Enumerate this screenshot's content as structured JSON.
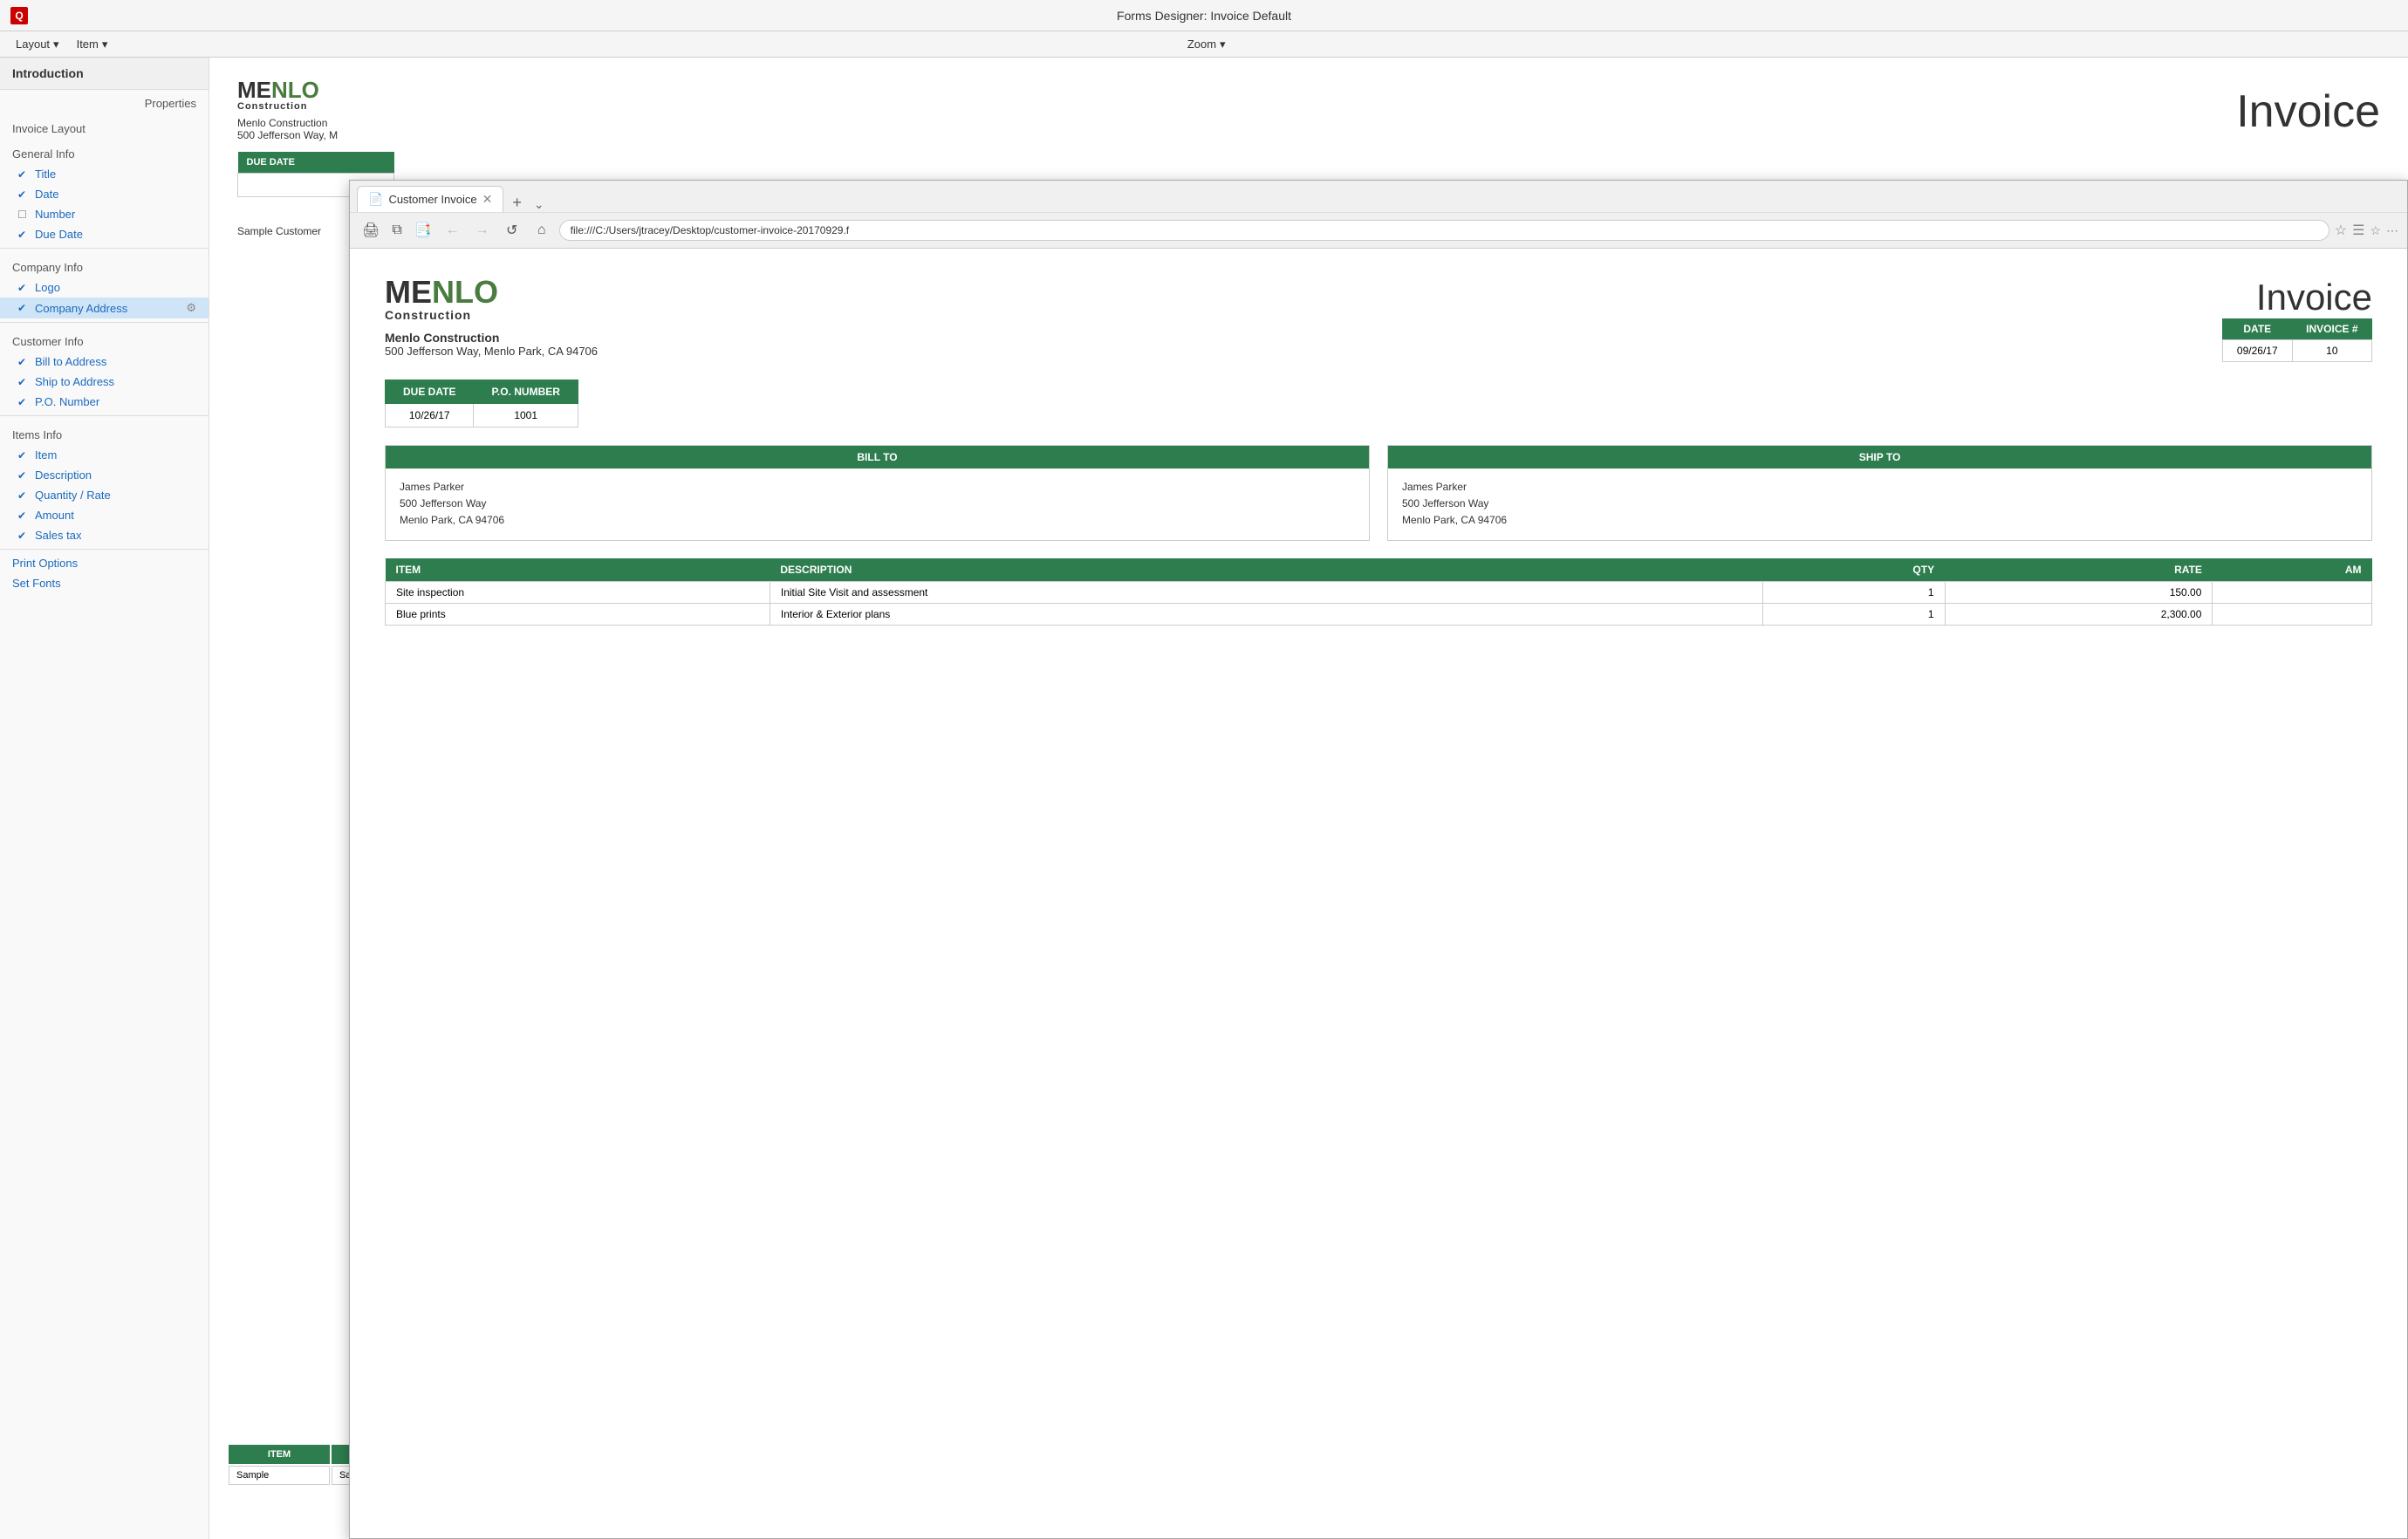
{
  "titleBar": {
    "iconLabel": "Q",
    "title": "Forms Designer:  Invoice Default"
  },
  "menuBar": {
    "items": [
      {
        "label": "Layout",
        "hasArrow": true
      },
      {
        "label": "Item",
        "hasArrow": true
      },
      {
        "label": "Zoom",
        "hasArrow": true,
        "centered": true
      }
    ]
  },
  "sidebar": {
    "header": "Introduction",
    "propsLabel": "Properties",
    "invoiceLayoutLabel": "Invoice Layout",
    "generalInfoLabel": "General Info",
    "generalInfoItems": [
      {
        "label": "Title",
        "checked": true
      },
      {
        "label": "Date",
        "checked": true
      },
      {
        "label": "Number",
        "checked": false
      },
      {
        "label": "Due Date",
        "checked": true
      }
    ],
    "companyInfoLabel": "Company Info",
    "companyInfoItems": [
      {
        "label": "Logo",
        "checked": true,
        "hasGear": false
      },
      {
        "label": "Company Address",
        "checked": true,
        "hasGear": true,
        "highlighted": true
      }
    ],
    "customerInfoLabel": "Customer Info",
    "customerInfoItems": [
      {
        "label": "Bill to Address",
        "checked": true
      },
      {
        "label": "Ship to Address",
        "checked": true
      },
      {
        "label": "P.O. Number",
        "checked": true
      }
    ],
    "itemsInfoLabel": "Items Info",
    "itemsInfoItems": [
      {
        "label": "Item",
        "checked": true
      },
      {
        "label": "Description",
        "checked": true
      },
      {
        "label": "Quantity / Rate",
        "checked": true
      },
      {
        "label": "Amount",
        "checked": true
      },
      {
        "label": "Sales tax",
        "checked": true
      }
    ],
    "printOptionsLabel": "Print Options",
    "setFontsLabel": "Set Fonts"
  },
  "invoicePreview": {
    "title": "Invoice",
    "logoME": "ME",
    "logoNL": "NLO",
    "logoConstruction": "Construction",
    "companyName": "Menlo Construction",
    "companyAddress": "500 Jefferson Way, M",
    "dueDateHeader": "DUE DATE",
    "customerName": "Sample Customer",
    "itemHeader": "ITEM"
  },
  "browser": {
    "tabLabel": "Customer Invoice",
    "addressBar": "file:///C:/Users/jtracey/Desktop/customer-invoice-20170929.f",
    "navButtons": [
      "←",
      "→",
      "↺",
      "⌂"
    ]
  },
  "invoice": {
    "title": "Invoice",
    "logoME": "ME",
    "logoNL": "NLO",
    "logoConstruction": "Construction",
    "companyName": "Menlo Construction",
    "companyAddress": "500 Jefferson Way, Menlo Park, CA 94706",
    "infoTable": {
      "headers": [
        "DATE",
        "INVOICE #"
      ],
      "rows": [
        [
          "09/26/17",
          "10"
        ]
      ]
    },
    "duePOTable": {
      "headers": [
        "DUE DATE",
        "P.O. NUMBER"
      ],
      "rows": [
        [
          "10/26/17",
          "1001"
        ]
      ]
    },
    "billTo": {
      "header": "BILL TO",
      "name": "James Parker",
      "address1": "500 Jefferson Way",
      "address2": "Menlo Park, CA 94706"
    },
    "shipTo": {
      "header": "SHIP TO",
      "name": "James Parker",
      "address1": "500 Jefferson Way",
      "address2": "Menlo Park, CA 94706"
    },
    "itemsTable": {
      "headers": [
        "ITEM",
        "DESCRIPTION",
        "QTY",
        "RATE",
        "AM"
      ],
      "rows": [
        [
          "Site inspection",
          "Initial Site Visit and assessment",
          "1",
          "150.00",
          ""
        ],
        [
          "Blue prints",
          "Interior & Exterior plans",
          "1",
          "2,300.00",
          ""
        ]
      ]
    }
  }
}
